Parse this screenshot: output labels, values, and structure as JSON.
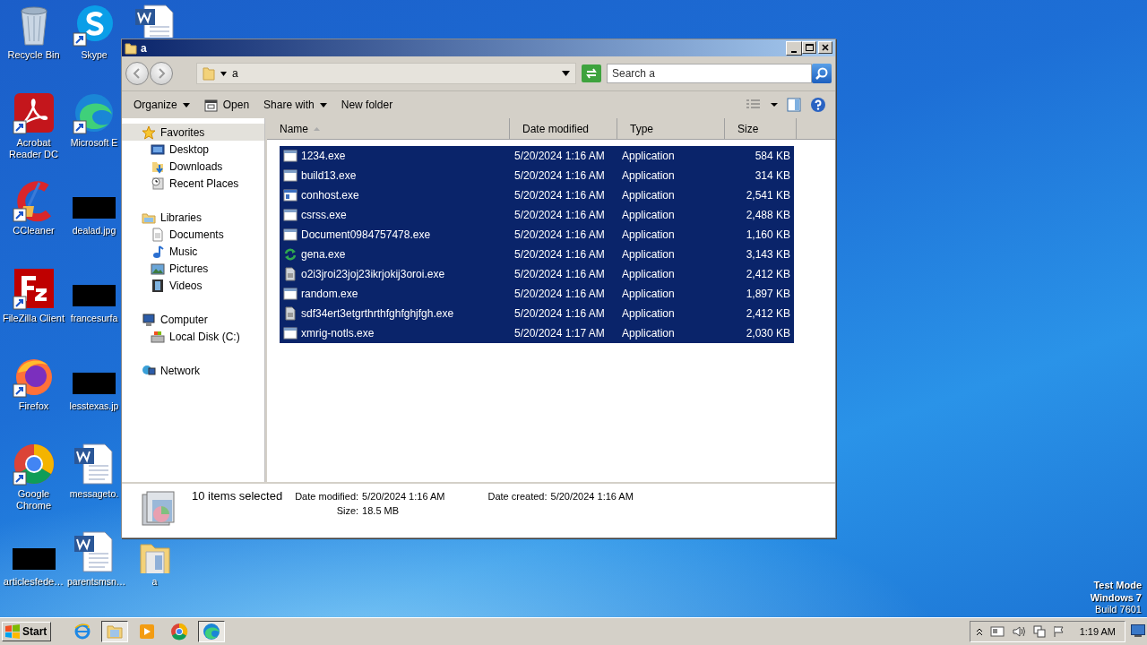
{
  "desktop": {
    "icons": [
      {
        "label": "Recycle Bin",
        "kind": "recycle-bin",
        "shortcut": false
      },
      {
        "label": "Acrobat Reader DC",
        "kind": "acrobat",
        "shortcut": true
      },
      {
        "label": "CCleaner",
        "kind": "ccleaner",
        "shortcut": true
      },
      {
        "label": "FileZilla Client",
        "kind": "filezilla",
        "shortcut": true
      },
      {
        "label": "Firefox",
        "kind": "firefox",
        "shortcut": true
      },
      {
        "label": "Google Chrome",
        "kind": "chrome",
        "shortcut": true
      },
      {
        "label": "articlesfede…",
        "kind": "redacted",
        "shortcut": false
      },
      {
        "label": "Skype",
        "kind": "skype",
        "shortcut": true
      },
      {
        "label": "Microsoft E",
        "kind": "edge",
        "shortcut": true
      },
      {
        "label": "dealad.jpg",
        "kind": "redacted",
        "shortcut": false
      },
      {
        "label": "francesurfa",
        "kind": "redacted",
        "shortcut": false
      },
      {
        "label": "lesstexas.jp",
        "kind": "redacted",
        "shortcut": false
      },
      {
        "label": "messageto.",
        "kind": "word",
        "shortcut": false
      },
      {
        "label": "parentsmsn…",
        "kind": "word",
        "shortcut": false
      },
      {
        "kind": "word",
        "shortcut": false
      },
      {
        "label": "a",
        "kind": "folder",
        "shortcut": false
      }
    ],
    "mode_text": [
      {
        "text": "Test Mode",
        "bold": true
      },
      {
        "text": "Windows 7",
        "bold": true
      },
      {
        "text": "Build 7601",
        "bold": false
      }
    ]
  },
  "window": {
    "title": "a",
    "address": {
      "path": "a"
    },
    "search": {
      "placeholder": "Search a"
    },
    "toolbar": [
      {
        "label": "Organize",
        "kind": "menu"
      },
      {
        "label": "Open",
        "kind": "open"
      },
      {
        "label": "Share with",
        "kind": "menu"
      },
      {
        "label": "New folder",
        "kind": "plain"
      }
    ],
    "nav": [
      {
        "label": "Favorites",
        "kind": "star",
        "highlighted": true,
        "children": [
          {
            "label": "Desktop",
            "kind": "desktop",
            "highlighted": false
          },
          {
            "label": "Downloads",
            "kind": "downloads",
            "highlighted": false
          },
          {
            "label": "Recent Places",
            "kind": "recent",
            "highlighted": false
          }
        ]
      },
      {
        "label": "Libraries",
        "kind": "libraries",
        "highlighted": false,
        "children": [
          {
            "label": "Documents",
            "kind": "documents",
            "highlighted": false
          },
          {
            "label": "Music",
            "kind": "music",
            "highlighted": false
          },
          {
            "label": "Pictures",
            "kind": "pictures",
            "highlighted": false
          },
          {
            "label": "Videos",
            "kind": "videos",
            "highlighted": false
          }
        ]
      },
      {
        "label": "Computer",
        "kind": "computer",
        "highlighted": false,
        "children": [
          {
            "label": "Local Disk (C:)",
            "kind": "disk",
            "highlighted": false
          }
        ]
      },
      {
        "label": "Network",
        "kind": "network",
        "highlighted": false
      }
    ],
    "columns": [
      {
        "label": "Name",
        "sorted": true
      },
      {
        "label": "Date modified",
        "sorted": false
      },
      {
        "label": "Type",
        "sorted": false
      },
      {
        "label": "Size",
        "sorted": false
      }
    ],
    "rows": [
      {
        "name": "1234.exe",
        "date": "5/20/2024 1:16 AM",
        "type": "Application",
        "size": "584 KB",
        "kind": "app",
        "selected": true
      },
      {
        "name": "build13.exe",
        "date": "5/20/2024 1:16 AM",
        "type": "Application",
        "size": "314 KB",
        "kind": "app",
        "selected": true
      },
      {
        "name": "conhost.exe",
        "date": "5/20/2024 1:16 AM",
        "type": "Application",
        "size": "2,541 KB",
        "kind": "app-blue",
        "selected": true
      },
      {
        "name": "csrss.exe",
        "date": "5/20/2024 1:16 AM",
        "type": "Application",
        "size": "2,488 KB",
        "kind": "app",
        "selected": true
      },
      {
        "name": "Document0984757478.exe",
        "date": "5/20/2024 1:16 AM",
        "type": "Application",
        "size": "1,160 KB",
        "kind": "app",
        "selected": true
      },
      {
        "name": "gena.exe",
        "date": "5/20/2024 1:16 AM",
        "type": "Application",
        "size": "3,143 KB",
        "kind": "arrows",
        "selected": true
      },
      {
        "name": "o2i3jroi23joj23ikrjokij3oroi.exe",
        "date": "5/20/2024 1:16 AM",
        "type": "Application",
        "size": "2,412 KB",
        "kind": "file",
        "selected": true
      },
      {
        "name": "random.exe",
        "date": "5/20/2024 1:16 AM",
        "type": "Application",
        "size": "1,897 KB",
        "kind": "app",
        "selected": true
      },
      {
        "name": "sdf34ert3etgrthrthfghfghjfgh.exe",
        "date": "5/20/2024 1:16 AM",
        "type": "Application",
        "size": "2,412 KB",
        "kind": "file",
        "selected": true
      },
      {
        "name": "xmrig-notls.exe",
        "date": "5/20/2024 1:17 AM",
        "type": "Application",
        "size": "2,030 KB",
        "kind": "app",
        "selected": true
      }
    ],
    "details": {
      "summary": "10 items selected",
      "fields": [
        {
          "label": "Date modified:",
          "value": "5/20/2024 1:16 AM"
        },
        {
          "label": "Date created:",
          "value": "5/20/2024 1:16 AM"
        },
        {
          "label": "Size:",
          "value": "18.5 MB"
        }
      ]
    }
  },
  "taskbar": {
    "start": "Start",
    "apps": [
      {
        "kind": "ie",
        "open": false
      },
      {
        "kind": "explorer",
        "open": true
      },
      {
        "kind": "media",
        "open": false
      },
      {
        "kind": "chrome",
        "open": false
      },
      {
        "kind": "edge",
        "open": true
      }
    ],
    "clock": "1:19 AM"
  }
}
